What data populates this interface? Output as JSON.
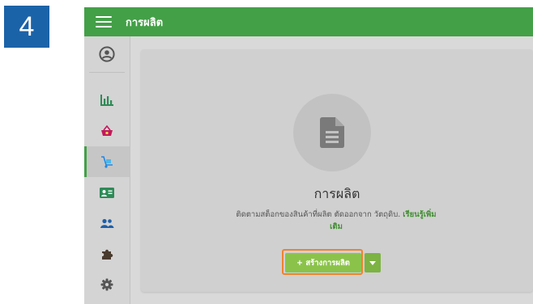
{
  "step_badge": "4",
  "header": {
    "title": "การผลิต",
    "color": "#43a047"
  },
  "sidebar": {
    "items": [
      {
        "icon": "user-circle-icon",
        "active": false
      },
      {
        "icon": "bar-chart-icon",
        "active": false
      },
      {
        "icon": "shopping-basket-icon",
        "active": false
      },
      {
        "icon": "hand-truck-icon",
        "active": true
      },
      {
        "icon": "contact-card-icon",
        "active": false
      },
      {
        "icon": "users-icon",
        "active": false
      },
      {
        "icon": "puzzle-icon",
        "active": false
      },
      {
        "icon": "gear-icon",
        "active": false
      }
    ]
  },
  "empty_state": {
    "icon": "document-icon",
    "title": "การผลิต",
    "description": "ติดตามสต็อกของสินค้าที่ผลิต ตัดออกจาก วัตถุดิบ.",
    "learn_more": "เรียนรู้เพิ่มเติม",
    "create_button": "+ สร้างการผลิต",
    "dropdown_icon": "caret-down-icon"
  },
  "colors": {
    "accent": "#43a047",
    "button": "#8bc34a",
    "highlight": "#f0822f",
    "badge": "#1b63a8"
  }
}
